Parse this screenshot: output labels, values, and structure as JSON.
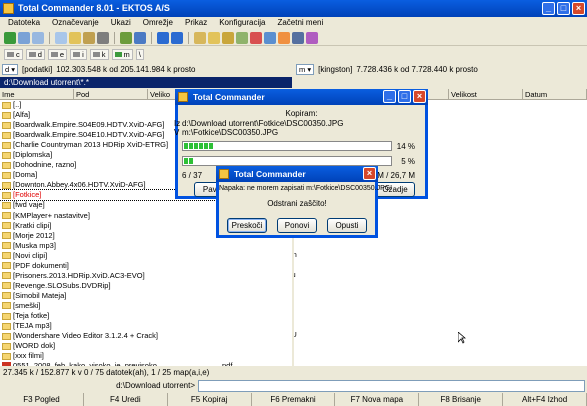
{
  "window": {
    "title": "Total Commander 8.01 - EKTOS A/S"
  },
  "menu": [
    "Datoteka",
    "Označevanje",
    "Ukazi",
    "Omrežje",
    "Prikaz",
    "Konfiguracija",
    "Začetni meni"
  ],
  "drives": [
    "c",
    "d",
    "e",
    "i",
    "k",
    "m",
    "\\"
  ],
  "left_panel": {
    "drive": "d",
    "label": "[podatki]",
    "space": "102.303.548 k od 205.141.984 k prosto",
    "path": "d:\\Download utorrent\\*.*",
    "columns": [
      "Ime",
      "Pod",
      "Veliko"
    ],
    "rows": [
      "[..]",
      "[Alfa]",
      "[Boardwalk.Empire.S04E09.HDTV.XviD-AFG]",
      "[Boardwalk.Empire.S04E10.HDTV.XviD-AFG]",
      "[Charlie Countryman 2013 HDRip XviD-ETRG]",
      "[Diplomska]",
      "[Dohodnine, razno]",
      "[Doma]",
      "[Downton.Abbey.4x06.HDTV.XviD-AFG]",
      "[Fotkice]",
      "[fwd vaje]",
      "[KMPlayer+ nastavitve]",
      "[Kratki clipi]",
      "[Morje 2012]",
      "[Muska mp3]",
      "[Novi clipi]",
      "[PDF dokumenti]",
      "[Prisoners.2013.HDRip.XviD.AC3-EVO]",
      "[Revenge.SLOSubs.DVDRip]",
      "[Simobil Mateja]",
      "[smeški]",
      "[Teja fotke]",
      "[TEJA mp3]",
      "[Wondershare Video Editor 3.1.2.4 + Crack]",
      "[WORD dok]",
      "[xxx filmi]",
      "0551_2008_feb_kako_visoko_je_previsoko"
    ],
    "last_ext": "pdf"
  },
  "right_panel": {
    "drive": "m",
    "label": "[kingston]",
    "space": "7.728.436 k od 7.728.440 k prosto",
    "columns": [
      "Velikost",
      "Datum"
    ],
    "partial_rows": [
      "Dropbox 2.0.26",
      "DT-Smej se ob n",
      "Duh_iz_svetilke",
      "dvdshrink32setu",
      "GETO Celovski",
      "Gregor Mavrič",
      "hfs",
      "hiša",
      "IDENTIFIKACIJ",
      "Klima v avtu_NU",
      "kolektiv_zapik.s",
      "Križnar zobar"
    ]
  },
  "copy_dialog": {
    "title": "Total Commander",
    "heading": "Kopiram:",
    "from_label": "Iz",
    "from": "d:\\Download utorrent\\Fotkice\\DSC00350.JPG",
    "to_label": "V",
    "to": "m:\\Fotkice\\DSC00350.JPG",
    "pct1": "14 %",
    "pct1_value": 0.14,
    "pct2": "5 %",
    "pct2_value": 0.05,
    "count": "6 / 37",
    "size": "24,7 M / 26,7 M",
    "btn_pause": "Pavza",
    "btn_back": "Ozadje"
  },
  "error_dialog": {
    "title": "Total Commander",
    "message": "Napaka: ne morem zapisati m:\\Fotkice\\DSC00350.JPG!",
    "sub": "Odstrani zaščito!",
    "buttons": [
      "Preskoči",
      "Ponovi",
      "Opusti"
    ]
  },
  "status": "27.345 k / 152.877 k v 0 / 75 datotek(ah), 1 / 25 map(a,i,e)",
  "cmd_label": "d:\\Download utorrent>",
  "fkeys": [
    "F3 Pogled",
    "F4 Uredi",
    "F5 Kopiraj",
    "F6 Premakni",
    "F7 Nova mapa",
    "F8 Brisanje",
    "Alt+F4 Izhod"
  ]
}
